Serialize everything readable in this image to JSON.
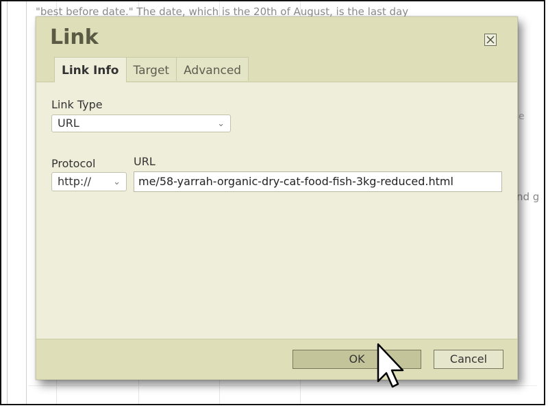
{
  "background": {
    "text_line_1": "\"best before date.\" The date, which is the 20th of August, is the last day",
    "text_line_0": "...",
    "right_fragment": "nd g",
    "right_fragment_2": "e"
  },
  "dialog": {
    "title": "Link",
    "close_icon": "close-icon",
    "tabs": [
      {
        "label": "Link Info",
        "active": true
      },
      {
        "label": "Target",
        "active": false
      },
      {
        "label": "Advanced",
        "active": false
      }
    ],
    "link_type": {
      "label": "Link Type",
      "value": "URL"
    },
    "protocol": {
      "label": "Protocol",
      "value": "http://"
    },
    "url": {
      "label": "URL",
      "value": "me/58-yarrah-organic-dry-cat-food-fish-3kg-reduced.html"
    },
    "buttons": {
      "ok": "OK",
      "cancel": "Cancel"
    }
  },
  "colors": {
    "dialog_bg": "#eeeedb",
    "header_bg": "#dedeb8",
    "ok_bg": "#c4c49a"
  }
}
